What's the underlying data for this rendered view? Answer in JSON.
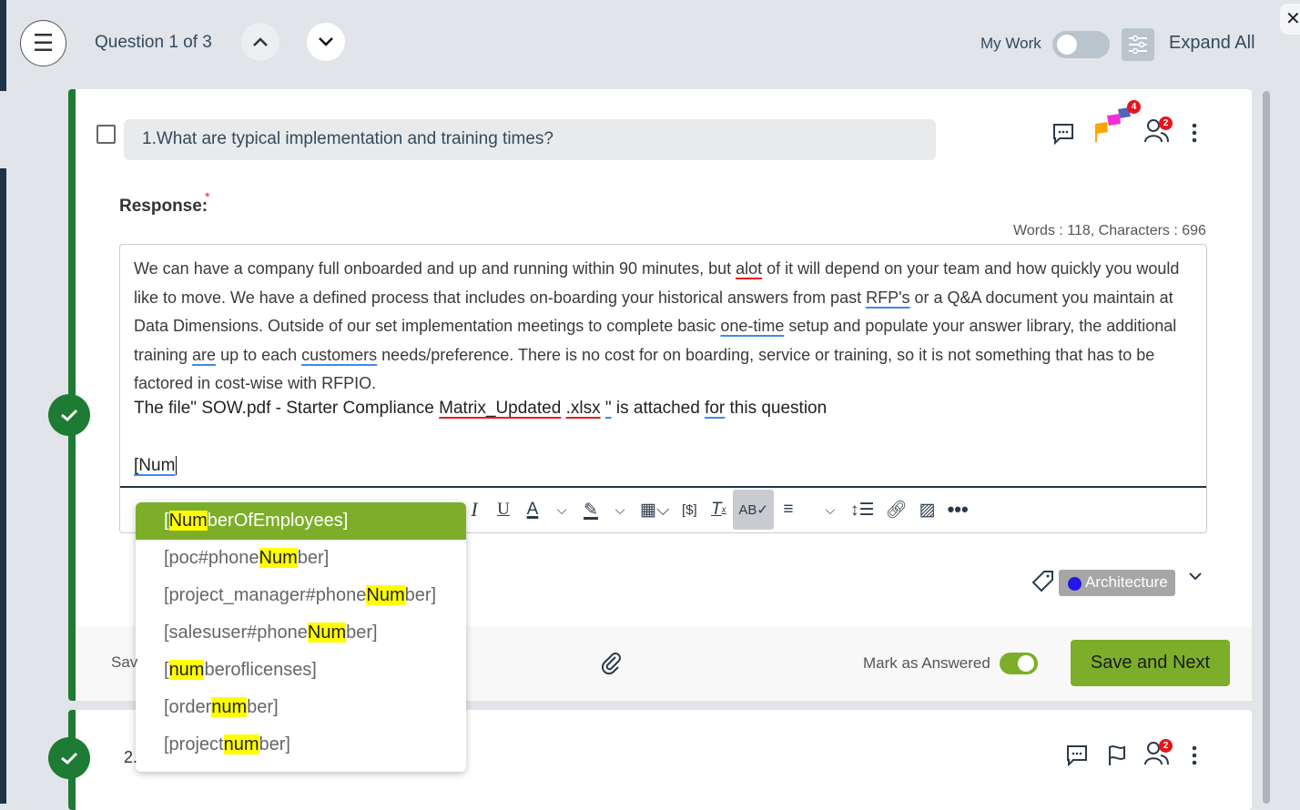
{
  "header": {
    "question_counter": "Question 1 of 3",
    "my_work_label": "My Work",
    "my_work_on": false,
    "expand_all_label": "Expand All"
  },
  "question1": {
    "title": "1.What are typical implementation and training times?",
    "flag_count": "4",
    "assignee_count": "2",
    "response_label": "Response:",
    "required_mark": "*",
    "counts": "Words : 118, Characters : 696",
    "response_text": {
      "p1_a": "We can have a company full onboarded and up and running within 90 minutes, but ",
      "p1_alot": "alot",
      "p1_b": " of it will depend on your team and how quickly you would like to move. We have a defined process that includes on-boarding your historical answers from past ",
      "p1_rfp": "RFP's",
      "p1_c": " or a Q&A document you maintain at Data Dimensions. Outside of our set implementation meetings to complete basic ",
      "p1_onetime": "one-time",
      "p1_d": " setup and populate your answer library, the additional training ",
      "p1_are": "are",
      "p1_e": " up to each ",
      "p1_customers": "customers",
      "p1_f": " needs/preference. There is no cost for on boarding, service or training, so it is not something that has to be factored in cost-wise with RFPIO.",
      "file_a": "The file\" SOW.pdf - Starter Compliance ",
      "file_matrix": "Matrix_Updated",
      "file_sp": " ",
      "file_xlsx": ".xlsx",
      "file_sp2": " ",
      "file_quote": "\"",
      "file_b": " is attached ",
      "file_for": "for",
      "file_c": " this question",
      "typed": "[Num"
    },
    "autocomplete": [
      {
        "pre": "[",
        "match": "Num",
        "post": "berOfEmployees]",
        "selected": true
      },
      {
        "pre": "[poc#phone",
        "match": "Num",
        "post": "ber]",
        "selected": false
      },
      {
        "pre": "[project_manager#phone",
        "match": "Num",
        "post": "ber]",
        "selected": false
      },
      {
        "pre": "[salesuser#phone",
        "match": "Num",
        "post": "ber]",
        "selected": false
      },
      {
        "pre": "[",
        "match": "num",
        "post": "beroflicenses]",
        "selected": false
      },
      {
        "pre": "[order",
        "match": "num",
        "post": "ber]",
        "selected": false
      },
      {
        "pre": "[project",
        "match": "num",
        "post": "ber]",
        "selected": false
      }
    ],
    "tag": "Architecture",
    "tag_color": "#1f18e8",
    "footer_left_partial": "Sav",
    "mark_answered_label": "Mark as Answered",
    "mark_answered_on": true,
    "save_next_label": "Save and Next"
  },
  "question2": {
    "number_partial": "2.",
    "assignee_count": "2"
  },
  "colors": {
    "accent_green": "#7cae2a",
    "status_green": "#1e7b34",
    "highlight": "#ffff00"
  }
}
